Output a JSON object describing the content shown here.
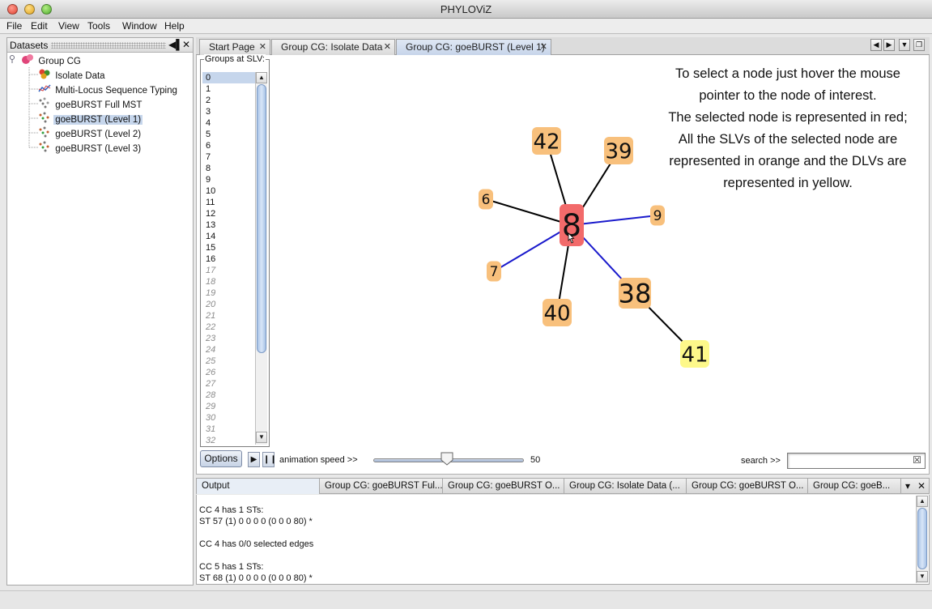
{
  "window": {
    "title": "PHYLOViZ"
  },
  "menu": [
    "File",
    "Edit",
    "View",
    "Tools",
    "Window",
    "Help"
  ],
  "datasets_panel": {
    "title": "Datasets",
    "root": "Group CG",
    "items": [
      "Isolate Data",
      "Multi-Locus Sequence Typing",
      "goeBURST Full MST",
      "goeBURST (Level 1)",
      "goeBURST (Level 2)",
      "goeBURST (Level 3)"
    ],
    "selected": "goeBURST (Level 1)"
  },
  "tabs": [
    {
      "label": "Start Page"
    },
    {
      "label": "Group CG: Isolate Data"
    },
    {
      "label": "Group CG: goeBURST (Level 1)"
    }
  ],
  "groups_panel": {
    "title": "Groups at SLV:",
    "items": [
      "0",
      "1",
      "2",
      "3",
      "4",
      "5",
      "6",
      "7",
      "8",
      "9",
      "10",
      "11",
      "12",
      "13",
      "14",
      "15",
      "16",
      "17",
      "18",
      "19",
      "20",
      "21",
      "22",
      "23",
      "24",
      "25",
      "26",
      "27",
      "28",
      "29",
      "30",
      "31",
      "32"
    ],
    "selected": "0",
    "active_count": 17
  },
  "info_text": [
    "To select a node just hover the mouse",
    "pointer to the node of interest.",
    "The selected node is represented in red;",
    "All the SLVs of the selected node are",
    "represented in orange and the DLVs are",
    "represented in yellow."
  ],
  "graph": {
    "colors": {
      "selected": "#f26a6a",
      "slv": "#f8c07c",
      "dlv": "#fdf88a",
      "edge_default": "#000000",
      "edge_selected": "#1a1acc"
    },
    "nodes": [
      {
        "id": "8",
        "role": "selected"
      },
      {
        "id": "42",
        "role": "slv"
      },
      {
        "id": "39",
        "role": "slv"
      },
      {
        "id": "6",
        "role": "slv"
      },
      {
        "id": "9",
        "role": "slv"
      },
      {
        "id": "7",
        "role": "slv"
      },
      {
        "id": "40",
        "role": "slv"
      },
      {
        "id": "38",
        "role": "slv"
      },
      {
        "id": "41",
        "role": "dlv"
      }
    ],
    "edges": [
      {
        "from": "8",
        "to": "42",
        "highlight": false
      },
      {
        "from": "8",
        "to": "39",
        "highlight": false
      },
      {
        "from": "8",
        "to": "6",
        "highlight": false
      },
      {
        "from": "8",
        "to": "40",
        "highlight": false
      },
      {
        "from": "8",
        "to": "9",
        "highlight": true
      },
      {
        "from": "8",
        "to": "7",
        "highlight": true
      },
      {
        "from": "8",
        "to": "38",
        "highlight": true
      },
      {
        "from": "38",
        "to": "41",
        "highlight": false
      }
    ]
  },
  "controls": {
    "options_label": "Options",
    "play_icon": "play-icon",
    "pause_icon": "pause-icon",
    "animation_label": "animation speed >>",
    "animation_speed": 50,
    "animation_speed_text": "50",
    "search_label": "search >>",
    "search_value": ""
  },
  "output": {
    "tabs": [
      "Output",
      "Group CG: goeBURST Ful...",
      "Group CG: goeBURST O...",
      "Group CG: Isolate Data (...",
      "Group CG: goeBURST O...",
      "Group CG: goeB..."
    ],
    "lines": [
      "CC 4 has 1 STs:",
      "ST 57 (1) 0 0 0 0 (0 0 0 80) *",
      "",
      "CC 4 has 0/0 selected edges",
      "",
      "CC 5 has 1 STs:",
      "ST 68 (1) 0 0 0 0 (0 0 0 80) *"
    ]
  }
}
